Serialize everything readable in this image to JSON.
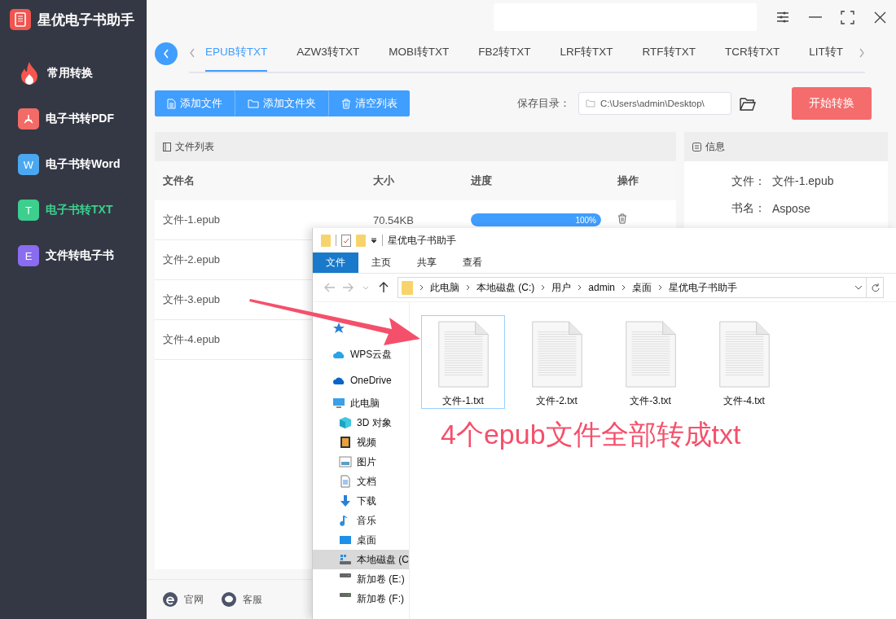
{
  "app": {
    "title": "星优电子书助手"
  },
  "sidebar": {
    "items": [
      {
        "label": "常用转换",
        "kind": "fire",
        "color": "#f5564e",
        "selected": false
      },
      {
        "label": "电子书转PDF",
        "kind": "pdf",
        "color": "#f26b67",
        "selected": false
      },
      {
        "label": "电子书转Word",
        "kind": "letter",
        "icon_letter": "W",
        "color": "#4ba8f0",
        "selected": false
      },
      {
        "label": "电子书转TXT",
        "kind": "letter",
        "icon_letter": "T",
        "color": "#3ccf8e",
        "selected": true
      },
      {
        "label": "文件转电子书",
        "kind": "letter",
        "icon_letter": "E",
        "color": "#8a6cf0",
        "selected": false
      }
    ]
  },
  "tabs": [
    {
      "label": "EPUB转TXT",
      "selected": true
    },
    {
      "label": "AZW3转TXT",
      "selected": false
    },
    {
      "label": "MOBI转TXT",
      "selected": false
    },
    {
      "label": "FB2转TXT",
      "selected": false
    },
    {
      "label": "LRF转TXT",
      "selected": false
    },
    {
      "label": "RTF转TXT",
      "selected": false
    },
    {
      "label": "TCR转TXT",
      "selected": false
    },
    {
      "label": "LIT转T",
      "selected": false
    }
  ],
  "toolbar": {
    "buttons": [
      {
        "label": "添加文件",
        "kind": "file"
      },
      {
        "label": "添加文件夹",
        "kind": "folder"
      },
      {
        "label": "清空列表",
        "kind": "trash"
      }
    ],
    "save_label": "保存目录：",
    "save_path": "C:\\Users\\admin\\Desktop\\",
    "start_button": "开始转换"
  },
  "file_list": {
    "title": "文件列表",
    "columns": [
      "文件名",
      "大小",
      "进度",
      "操作"
    ],
    "rows": [
      {
        "name": "文件-1.epub",
        "size": "70.54KB",
        "level": 1,
        "progress_text": "100%"
      },
      {
        "name": "文件-2.epub"
      },
      {
        "name": "文件-3.epub"
      },
      {
        "name": "文件-4.epub"
      }
    ]
  },
  "info": {
    "title": "信息",
    "fields": [
      {
        "label": "文件：",
        "value": "文件-1.epub"
      },
      {
        "label": "书名：",
        "value": "Aspose"
      }
    ]
  },
  "footer_links": [
    {
      "label": "官网",
      "kind": "web"
    },
    {
      "label": "客服",
      "kind": "chat"
    }
  ],
  "explorer": {
    "title": "星优电子书助手",
    "ribbon_tabs": [
      {
        "label": "文件",
        "selected": true
      },
      {
        "label": "主页",
        "selected": false
      },
      {
        "label": "共享",
        "selected": false
      },
      {
        "label": "查看",
        "selected": false
      }
    ],
    "breadcrumb": [
      "此电脑",
      "本地磁盘 (C:)",
      "用户",
      "admin",
      "桌面",
      "星优电子书助手"
    ],
    "nav": [
      {
        "kind": "star",
        "selected": false
      },
      {
        "label": "WPS云盘",
        "kind": "cloud-wps",
        "selected": false
      },
      {
        "label": "OneDrive",
        "kind": "cloud",
        "selected": false
      },
      {
        "label": "此电脑",
        "kind": "pc",
        "selected": false,
        "children": [
          {
            "label": "3D 对象",
            "kind": "cube",
            "selected": false
          },
          {
            "label": "视频",
            "kind": "video",
            "selected": false
          },
          {
            "label": "图片",
            "kind": "image",
            "selected": false
          },
          {
            "label": "文档",
            "kind": "doc",
            "selected": false
          },
          {
            "label": "下载",
            "kind": "download",
            "selected": false
          },
          {
            "label": "音乐",
            "kind": "music",
            "selected": false
          },
          {
            "label": "桌面",
            "kind": "desktop",
            "selected": false
          },
          {
            "label": "本地磁盘 (C",
            "kind": "windrive",
            "selected": true
          },
          {
            "label": "新加卷 (E:)",
            "kind": "drive",
            "selected": false
          },
          {
            "label": "新加卷 (F:)",
            "kind": "drive",
            "selected": false
          }
        ]
      }
    ],
    "files": [
      {
        "name": "文件-1.txt",
        "selected": true
      },
      {
        "name": "文件-2.txt",
        "selected": false
      },
      {
        "name": "文件-3.txt",
        "selected": false
      },
      {
        "name": "文件-4.txt",
        "selected": false
      }
    ]
  },
  "annotation": {
    "text": "4个epub文件全部转成txt"
  }
}
